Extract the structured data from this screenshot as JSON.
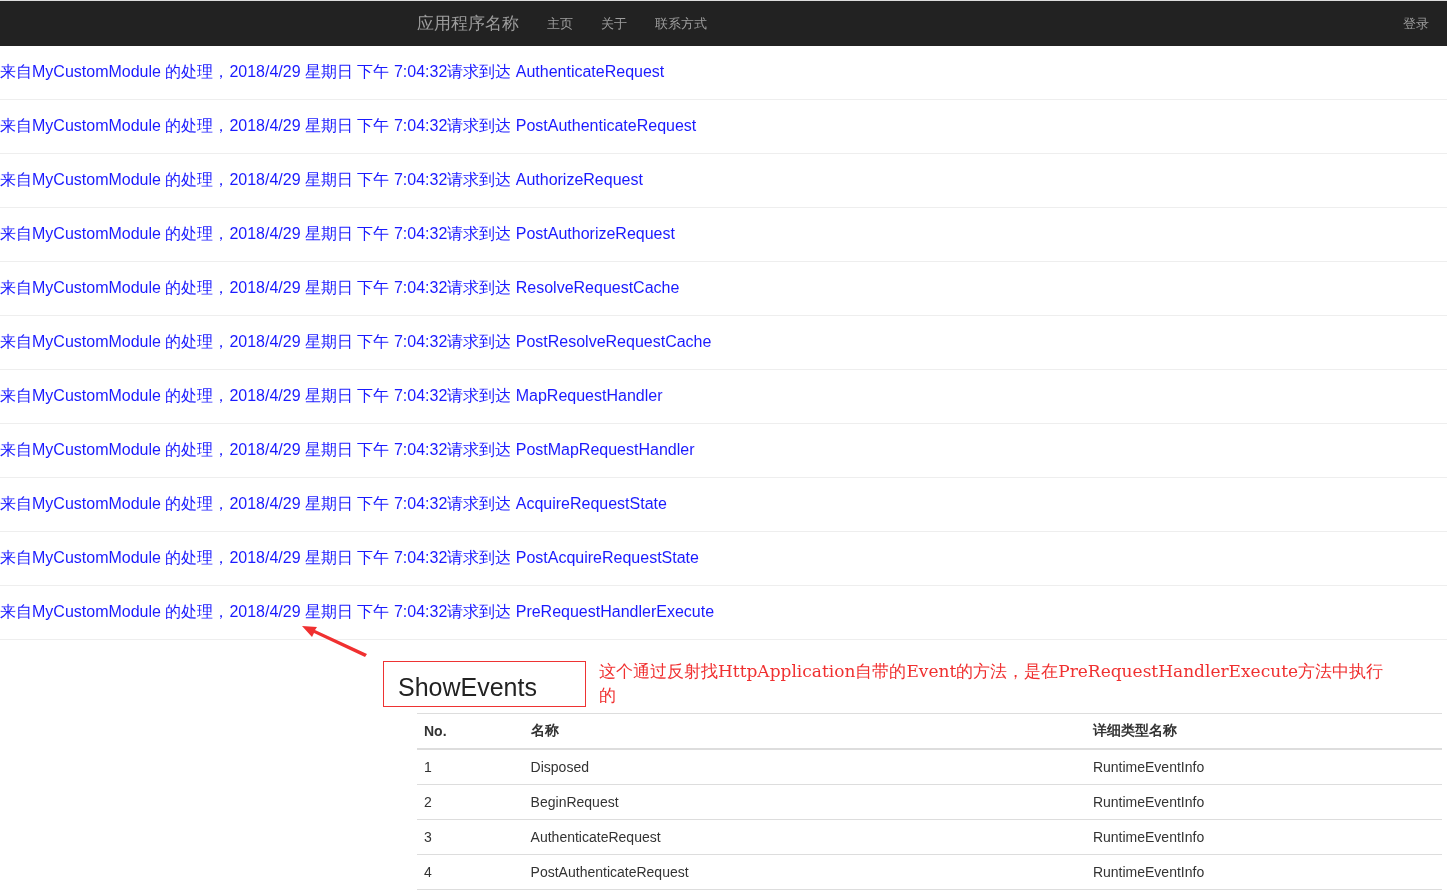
{
  "navbar": {
    "brand": "应用程序名称",
    "links": [
      "主页",
      "关于",
      "联系方式"
    ],
    "login": "登录"
  },
  "log_lines": [
    "来自MyCustomModule 的处理，2018/4/29 星期日 下午 7:04:32请求到达 AuthenticateRequest",
    "来自MyCustomModule 的处理，2018/4/29 星期日 下午 7:04:32请求到达 PostAuthenticateRequest",
    "来自MyCustomModule 的处理，2018/4/29 星期日 下午 7:04:32请求到达 AuthorizeRequest",
    "来自MyCustomModule 的处理，2018/4/29 星期日 下午 7:04:32请求到达 PostAuthorizeRequest",
    "来自MyCustomModule 的处理，2018/4/29 星期日 下午 7:04:32请求到达 ResolveRequestCache",
    "来自MyCustomModule 的处理，2018/4/29 星期日 下午 7:04:32请求到达 PostResolveRequestCache",
    "来自MyCustomModule 的处理，2018/4/29 星期日 下午 7:04:32请求到达 MapRequestHandler",
    "来自MyCustomModule 的处理，2018/4/29 星期日 下午 7:04:32请求到达 PostMapRequestHandler",
    "来自MyCustomModule 的处理，2018/4/29 星期日 下午 7:04:32请求到达 AcquireRequestState",
    "来自MyCustomModule 的处理，2018/4/29 星期日 下午 7:04:32请求到达 PostAcquireRequestState",
    "来自MyCustomModule 的处理，2018/4/29 星期日 下午 7:04:32请求到达 PreRequestHandlerExecute"
  ],
  "show_events_button": "ShowEvents",
  "annotation": "这个通过反射找HttpApplication自带的Event的方法，是在PreRequestHandlerExecute方法中执行的",
  "table": {
    "columns": [
      "No.",
      "名称",
      "详细类型名称"
    ],
    "rows": [
      [
        "1",
        "Disposed",
        "RuntimeEventInfo"
      ],
      [
        "2",
        "BeginRequest",
        "RuntimeEventInfo"
      ],
      [
        "3",
        "AuthenticateRequest",
        "RuntimeEventInfo"
      ],
      [
        "4",
        "PostAuthenticateRequest",
        "RuntimeEventInfo"
      ]
    ]
  }
}
